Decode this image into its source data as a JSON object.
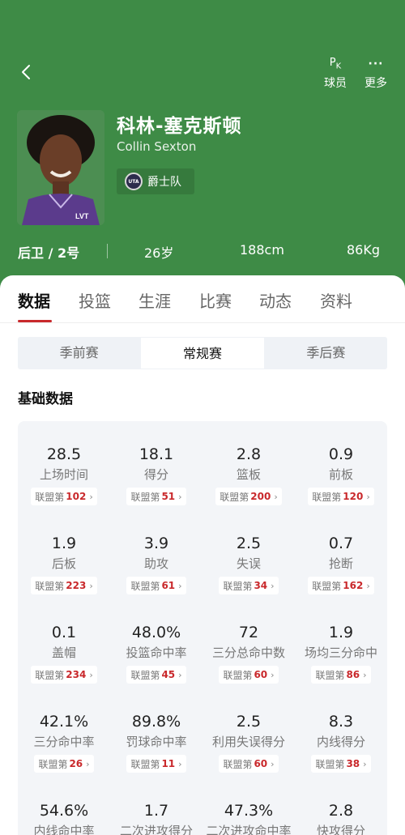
{
  "header": {
    "back_icon": "chevron-left-icon",
    "actions": [
      {
        "icon": "pk-icon",
        "label": "球员"
      },
      {
        "icon": "more-icon",
        "label": "更多"
      }
    ],
    "colors": {
      "background": "#3e8b46",
      "accent": "#c9292c"
    }
  },
  "player": {
    "name_cn": "科林-塞克斯顿",
    "name_en": "Collin Sexton",
    "team": "爵士队",
    "position": "后卫 / 2号",
    "age": "26岁",
    "height": "188cm",
    "weight": "86Kg"
  },
  "tabs": [
    "数据",
    "投篮",
    "生涯",
    "比赛",
    "动态",
    "资料"
  ],
  "segments": [
    "季前赛",
    "常规赛",
    "季后赛"
  ],
  "section_title": "基础数据",
  "rank_prefix": "联盟第",
  "stats": [
    {
      "value": "28.5",
      "label": "上场时间",
      "rank": "102"
    },
    {
      "value": "18.1",
      "label": "得分",
      "rank": "51"
    },
    {
      "value": "2.8",
      "label": "篮板",
      "rank": "200"
    },
    {
      "value": "0.9",
      "label": "前板",
      "rank": "120"
    },
    {
      "value": "1.9",
      "label": "后板",
      "rank": "223"
    },
    {
      "value": "3.9",
      "label": "助攻",
      "rank": "61"
    },
    {
      "value": "2.5",
      "label": "失误",
      "rank": "34"
    },
    {
      "value": "0.7",
      "label": "抢断",
      "rank": "162"
    },
    {
      "value": "0.1",
      "label": "盖帽",
      "rank": "234"
    },
    {
      "value": "48.0%",
      "label": "投篮命中率",
      "rank": "45"
    },
    {
      "value": "72",
      "label": "三分总命中数",
      "rank": "60"
    },
    {
      "value": "1.9",
      "label": "场均三分命中",
      "rank": "86"
    },
    {
      "value": "42.1%",
      "label": "三分命中率",
      "rank": "26"
    },
    {
      "value": "89.8%",
      "label": "罚球命中率",
      "rank": "11"
    },
    {
      "value": "2.5",
      "label": "利用失误得分",
      "rank": "60"
    },
    {
      "value": "8.3",
      "label": "内线得分",
      "rank": "38"
    },
    {
      "value": "54.6%",
      "label": "内线命中率",
      "rank": ""
    },
    {
      "value": "1.7",
      "label": "二次进攻得分",
      "rank": ""
    },
    {
      "value": "47.3%",
      "label": "二次进攻命中率",
      "rank": ""
    },
    {
      "value": "2.8",
      "label": "快攻得分",
      "rank": ""
    }
  ]
}
